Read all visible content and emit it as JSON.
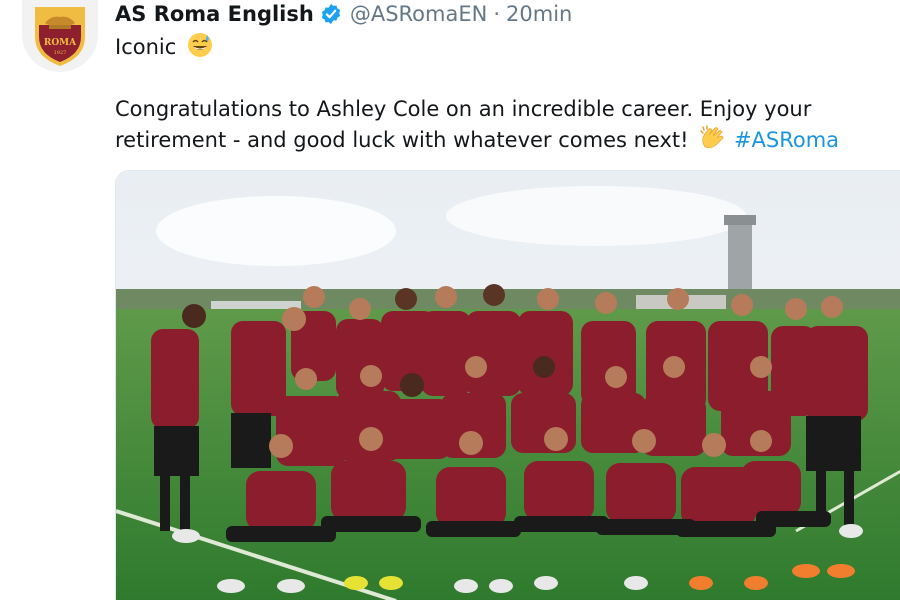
{
  "tweet": {
    "display_name": "AS Roma English",
    "handle": "@ASRomaEN",
    "separator": "·",
    "time": "20min",
    "line1": "Iconic",
    "line2a": "Congratulations to Ashley Cole on an incredible career. Enjoy your",
    "line2b": "retirement - and good luck with whatever comes next!",
    "hashtag": "#ASRoma"
  },
  "avatar": {
    "badge_text": "ROMA",
    "badge_year": "1927"
  },
  "icons": {
    "verified": "verified-badge-icon",
    "emoji_sweat_smile": "grinning-sweat-emoji-icon",
    "emoji_clap": "clapping-hands-emoji-icon"
  },
  "colors": {
    "name": "#14171a",
    "meta": "#657786",
    "link": "#1b95e0",
    "verified": "#1da1f2",
    "roma_red": "#8e1f2f",
    "roma_gold": "#f0bc42",
    "jersey": "#8b1d2c",
    "pitch": "#3f8a3a"
  }
}
